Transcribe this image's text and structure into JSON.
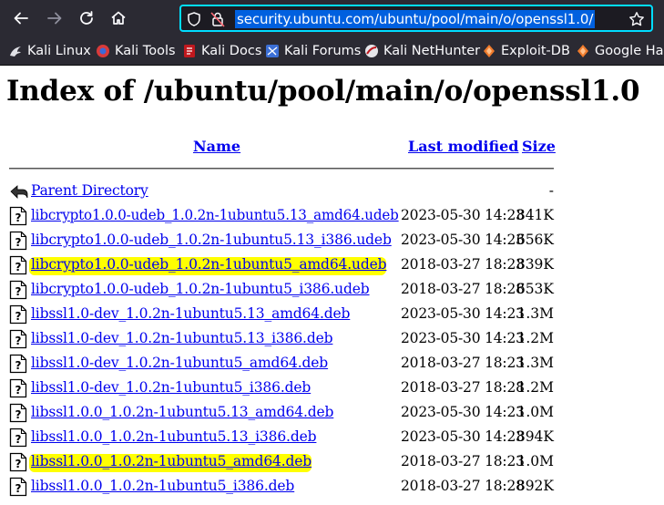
{
  "browser": {
    "url": "security.ubuntu.com/ubuntu/pool/main/o/openssl1.0/",
    "bookmarks": [
      {
        "label": "Kali Linux",
        "icon": "kali-dragon-icon"
      },
      {
        "label": "Kali Tools",
        "icon": "kali-tools-icon"
      },
      {
        "label": "Kali Docs",
        "icon": "kali-docs-icon"
      },
      {
        "label": "Kali Forums",
        "icon": "kali-forums-icon"
      },
      {
        "label": "Kali NetHunter",
        "icon": "kali-nethunter-icon"
      },
      {
        "label": "Exploit-DB",
        "icon": "exploit-db-icon"
      },
      {
        "label": "Google Hac",
        "icon": "google-hacking-icon"
      }
    ]
  },
  "page": {
    "title": "Index of /ubuntu/pool/main/o/openssl1.0",
    "columns": {
      "name": "Name",
      "last_modified": "Last modified",
      "size": "Size"
    },
    "parent": {
      "name": "Parent Directory",
      "size": "-"
    },
    "files": [
      {
        "name": "libcrypto1.0.0-udeb_1.0.2n-1ubuntu5.13_amd64.udeb",
        "date": "2023-05-30 14:23",
        "size": "841K",
        "highlighted": false
      },
      {
        "name": "libcrypto1.0.0-udeb_1.0.2n-1ubuntu5.13_i386.udeb",
        "date": "2023-05-30 14:23",
        "size": "656K",
        "highlighted": false
      },
      {
        "name": "libcrypto1.0.0-udeb_1.0.2n-1ubuntu5_amd64.udeb",
        "date": "2018-03-27 18:23",
        "size": "839K",
        "highlighted": true
      },
      {
        "name": "libcrypto1.0.0-udeb_1.0.2n-1ubuntu5_i386.udeb",
        "date": "2018-03-27 18:28",
        "size": "653K",
        "highlighted": false
      },
      {
        "name": "libssl1.0-dev_1.0.2n-1ubuntu5.13_amd64.deb",
        "date": "2023-05-30 14:23",
        "size": "1.3M",
        "highlighted": false
      },
      {
        "name": "libssl1.0-dev_1.0.2n-1ubuntu5.13_i386.deb",
        "date": "2023-05-30 14:23",
        "size": "1.2M",
        "highlighted": false
      },
      {
        "name": "libssl1.0-dev_1.0.2n-1ubuntu5_amd64.deb",
        "date": "2018-03-27 18:23",
        "size": "1.3M",
        "highlighted": false
      },
      {
        "name": "libssl1.0-dev_1.0.2n-1ubuntu5_i386.deb",
        "date": "2018-03-27 18:28",
        "size": "1.2M",
        "highlighted": false
      },
      {
        "name": "libssl1.0.0_1.0.2n-1ubuntu5.13_amd64.deb",
        "date": "2023-05-30 14:23",
        "size": "1.0M",
        "highlighted": false
      },
      {
        "name": "libssl1.0.0_1.0.2n-1ubuntu5.13_i386.deb",
        "date": "2023-05-30 14:23",
        "size": "894K",
        "highlighted": false
      },
      {
        "name": "libssl1.0.0_1.0.2n-1ubuntu5_amd64.deb",
        "date": "2018-03-27 18:23",
        "size": "1.0M",
        "highlighted": true
      },
      {
        "name": "libssl1.0.0_1.0.2n-1ubuntu5_i386.deb",
        "date": "2018-03-27 18:28",
        "size": "892K",
        "highlighted": false
      }
    ]
  },
  "colors": {
    "highlight": "#ffff00",
    "link": "#0000ee",
    "toolbar": "#2b2a33",
    "url_focus": "#00ddff"
  }
}
